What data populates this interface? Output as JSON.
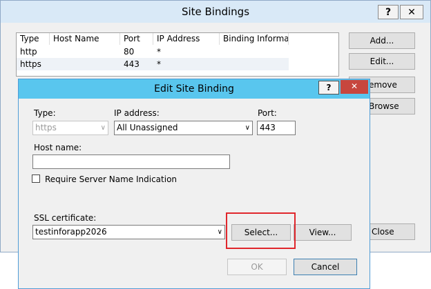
{
  "site_bindings": {
    "title": "Site Bindings",
    "help_glyph": "?",
    "close_glyph": "✕",
    "columns": [
      "Type",
      "Host Name",
      "Port",
      "IP Address",
      "Binding Informa..."
    ],
    "rows": [
      {
        "type": "http",
        "host": "",
        "port": "80",
        "ip": "*",
        "info": ""
      },
      {
        "type": "https",
        "host": "",
        "port": "443",
        "ip": "*",
        "info": ""
      }
    ],
    "buttons": {
      "add": "Add...",
      "edit": "Edit...",
      "remove_partial": "emove",
      "browse_partial": "Browse",
      "close_partial": "Close"
    }
  },
  "edit_binding": {
    "title": "Edit Site Binding",
    "help_glyph": "?",
    "close_glyph": "✕",
    "type_label": "Type:",
    "type_value": "https",
    "ip_label": "IP address:",
    "ip_value": "All Unassigned",
    "port_label": "Port:",
    "port_value": "443",
    "host_label": "Host name:",
    "host_value": "",
    "sni_label": "Require Server Name Indication",
    "sni_checked": false,
    "ssl_label": "SSL certificate:",
    "ssl_value": "testinforapp2026",
    "select_button": "Select...",
    "view_button": "View...",
    "ok_button": "OK",
    "cancel_button": "Cancel",
    "dropdown_glyph": "∨"
  },
  "colors": {
    "outer_titlebar": "#d9e9f7",
    "inner_titlebar": "#59c6ee",
    "close_red": "#c7463e",
    "highlight_red": "#e0262b"
  }
}
